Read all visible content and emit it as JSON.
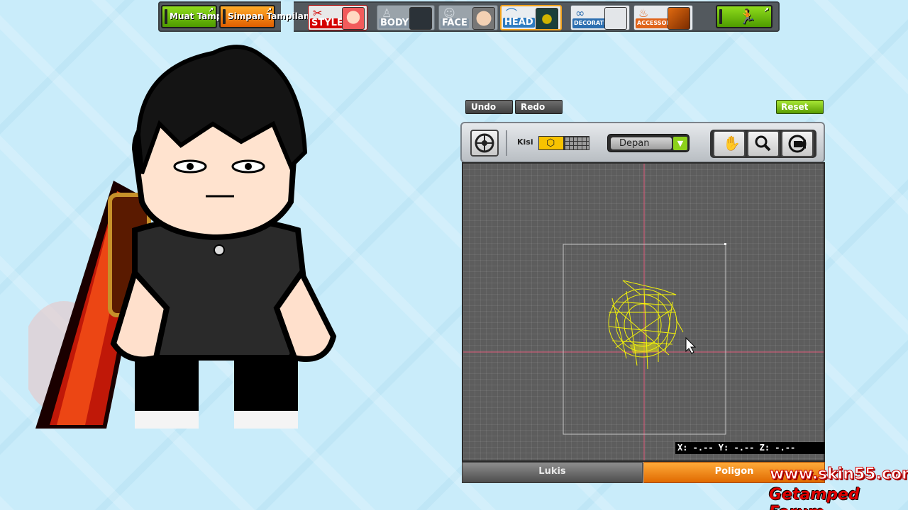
{
  "topbar": {
    "load_label": "Muat Tampilan",
    "save_label": "Simpan Tampilan",
    "categories": [
      {
        "label": "STYLE",
        "icon": "style-icon",
        "active": false
      },
      {
        "label": "BODY",
        "icon": "body-icon",
        "active": false
      },
      {
        "label": "FACE",
        "icon": "face-icon",
        "active": false
      },
      {
        "label": "HEAD",
        "icon": "head-icon",
        "active": true
      },
      {
        "label": "DECORATION",
        "icon": "glasses-icon",
        "active": false
      },
      {
        "label": "ACCESSORY",
        "icon": "flame-icon",
        "active": false
      }
    ],
    "exit_icon": "exit-icon"
  },
  "editor": {
    "undo_label": "Undo",
    "redo_label": "Redo",
    "reset_label": "Reset",
    "grid_label": "Kisi",
    "view_select": "Depan",
    "tools": [
      "pan-hand-icon",
      "zoom-icon",
      "rotate-camera-icon"
    ],
    "coords_text": "X: -.-- Y: -.-- Z: -.--",
    "tabs": [
      {
        "label": "Lukis",
        "active": false
      },
      {
        "label": "Poligon",
        "active": true
      }
    ]
  },
  "watermark": {
    "site": "www.skin55.com",
    "forum": "Getamped Forum"
  },
  "colors": {
    "green_button": "#6cc10e",
    "orange_button": "#f07a10",
    "canvas_bg": "#5d5d5d",
    "wireframe": "#f2f20a",
    "axis_line": "#e05a7a",
    "active_tab": "#f08a1c"
  }
}
